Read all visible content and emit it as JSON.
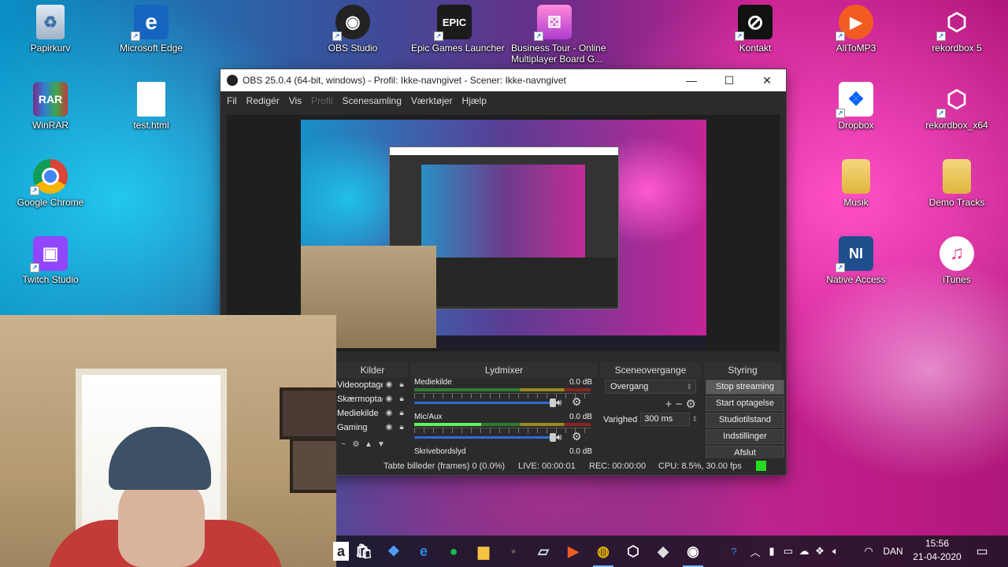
{
  "desktop": {
    "icons": [
      {
        "label": "Papirkurv",
        "icon": "recycle-bin-icon"
      },
      {
        "label": "Microsoft Edge",
        "icon": "edge-icon"
      },
      {
        "label": "OBS Studio",
        "icon": "obs-icon"
      },
      {
        "label": "Epic Games Launcher",
        "icon": "epic-games-icon"
      },
      {
        "label": "Business Tour - Online",
        "label2": "Multiplayer Board G...",
        "icon": "business-tour-icon"
      },
      {
        "label": "Kontakt",
        "icon": "kontakt-icon"
      },
      {
        "label": "AllToMP3",
        "icon": "alltomp3-icon"
      },
      {
        "label": "rekordbox 5",
        "icon": "rekordbox-icon"
      },
      {
        "label": "WinRAR",
        "icon": "winrar-icon"
      },
      {
        "label": "test.html",
        "icon": "file-icon"
      },
      {
        "label": "Dropbox",
        "icon": "dropbox-icon"
      },
      {
        "label": "rekordbox_x64",
        "icon": "rekordbox-icon"
      },
      {
        "label": "Google Chrome",
        "icon": "chrome-icon"
      },
      {
        "label": "Musik",
        "icon": "folder-icon"
      },
      {
        "label": "Demo Tracks",
        "icon": "folder-icon"
      },
      {
        "label": "Twitch Studio",
        "icon": "twitch-icon"
      },
      {
        "label": "Native Access",
        "icon": "native-access-icon"
      },
      {
        "label": "iTunes",
        "icon": "itunes-icon"
      }
    ]
  },
  "obs": {
    "title": "OBS 25.0.4 (64-bit, windows) - Profil: Ikke-navngivet - Scener: Ikke-navngivet",
    "minimize_glyph": "—",
    "maximize_glyph": "☐",
    "close_glyph": "✕",
    "menu": [
      "Fil",
      "Redigér",
      "Vis",
      "Profil",
      "Scenesamling",
      "Værktøjer",
      "Hjælp"
    ],
    "docks": {
      "sources_title": "Kilder",
      "mixer_title": "Lydmixer",
      "transitions_title": "Sceneovergange",
      "controls_title": "Styring"
    },
    "sources": [
      "Videooptagel",
      "Skærmoptag",
      "Mediekilde",
      "Gaming"
    ],
    "mixer": [
      {
        "name": "Mediekilde",
        "db": "0.0 dB"
      },
      {
        "name": "Mic/Aux",
        "db": "0.0 dB"
      },
      {
        "name": "Skrivebordslyd",
        "db": "0.0 dB"
      }
    ],
    "transitions": {
      "selected": "Overgang",
      "duration_label": "Varighed",
      "duration_value": "300 ms"
    },
    "controls": [
      "Stop streaming",
      "Start optagelse",
      "Studiotilstand",
      "Indstillinger",
      "Afslut"
    ],
    "status": {
      "dropped": "Tabte billeder (frames) 0 (0.0%)",
      "live": "LIVE: 00:00:01",
      "rec": "REC: 00:00:00",
      "cpu": "CPU: 8.5%, 30.00 fps"
    }
  },
  "taskbar": {
    "language": "DAN",
    "time": "15:56",
    "date": "21-04-2020"
  },
  "colors": {
    "obs_bg": "#2b2b2b",
    "status_ok": "#22dd22",
    "slider": "#2d6cd8"
  }
}
